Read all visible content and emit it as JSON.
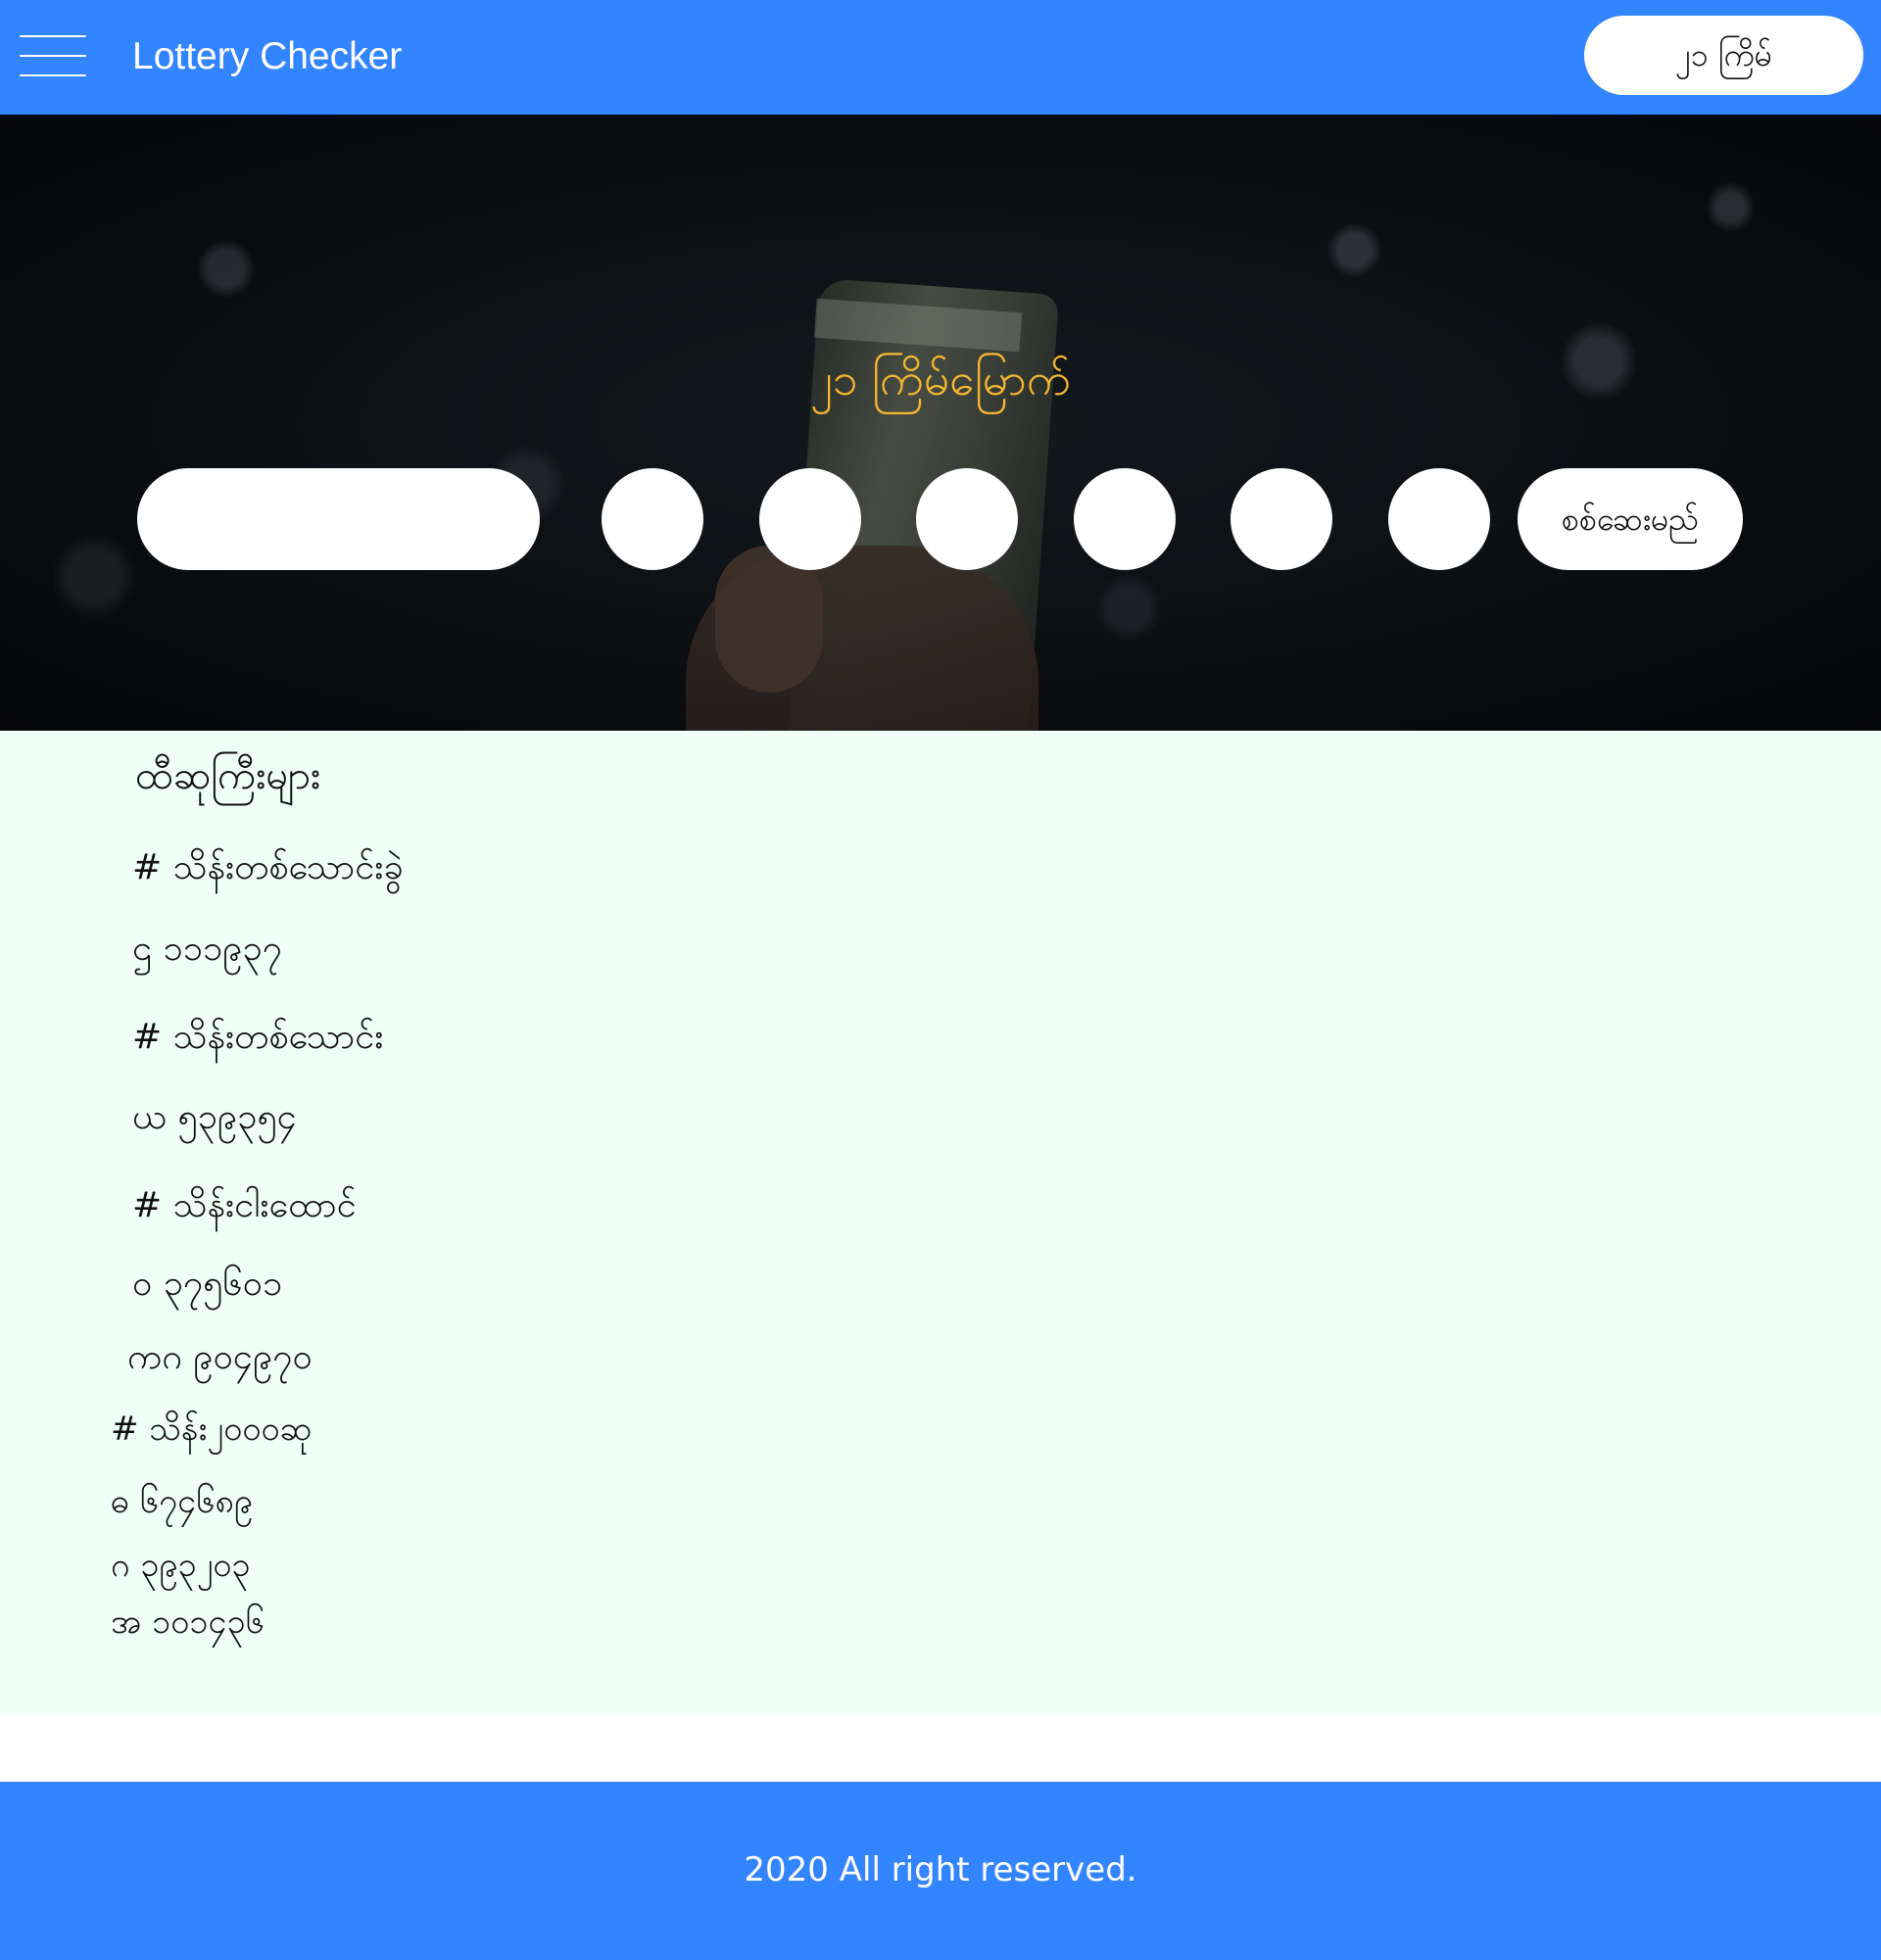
{
  "header": {
    "app_title": "Lottery Checker",
    "round_button": "၂၁ ကြိမ်",
    "menu_icon": "hamburger-menu-icon",
    "background_color": "#3385ff"
  },
  "hero": {
    "heading": "၂၁ ကြိမ်မြောက်",
    "heading_color": "#f5b731",
    "prefix_input": {
      "value": "",
      "placeholder": ""
    },
    "digit_inputs": [
      "",
      "",
      "",
      "",
      "",
      ""
    ],
    "check_button": "စစ်ဆေးမည်"
  },
  "prizes": {
    "title": "ထီဆုကြီးများ",
    "background_color": "#effff7",
    "sections": [
      {
        "heading": "# သိန်းတစ်သောင်းခွဲ",
        "numbers": [
          "ဌ ၁၁၁၉၃၇"
        ]
      },
      {
        "heading": "# သိန်းတစ်သောင်း",
        "numbers": [
          "ယ ၅၃၉၃၅၄"
        ]
      },
      {
        "heading": "# သိန်းငါးထောင်",
        "numbers": [
          "ဝ ၃၇၅၆၀၁",
          "ကဂ ၉၀၄၉၇၀"
        ]
      },
      {
        "heading": "# သိန်း၂၀၀၀ဆု",
        "numbers": [
          "ဓ ၆၇၄၆၈၉",
          "ဂ ၃၉၃၂၀၃",
          "အ ၁၀၁၄၃၆"
        ]
      }
    ]
  },
  "footer": {
    "text": "2020 All right reserved."
  }
}
